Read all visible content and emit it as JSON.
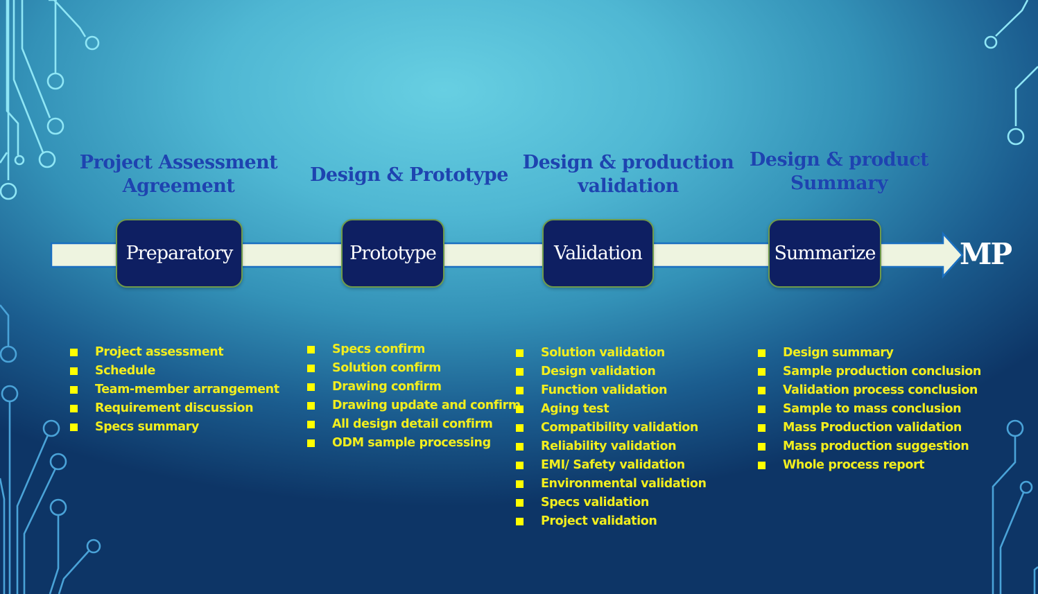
{
  "colors": {
    "title_text": "#1d44b0",
    "stage_box_fill": "#0e1f62",
    "stage_box_border": "#6f9a4a",
    "arrow_fill": "#eef4e0",
    "arrow_outline": "#1a6fc0",
    "task_text": "#f2ee1e",
    "bullet": "#ffff00",
    "circuit_line_light": "#8fe6f5",
    "circuit_line_dark": "#4aa3d8"
  },
  "phases": [
    {
      "title_line1": "Project Assessment",
      "title_line2": "Agreement",
      "stage": "Preparatory",
      "tasks": [
        "Project assessment",
        "Schedule",
        "Team-member arrangement",
        "Requirement discussion",
        "Specs summary"
      ]
    },
    {
      "title_line1": "Design & Prototype",
      "title_line2": "",
      "stage": "Prototype",
      "tasks": [
        "Specs confirm",
        "Solution confirm",
        "Drawing confirm",
        "Drawing update and confirm",
        "All design detail confirm",
        "ODM sample processing"
      ]
    },
    {
      "title_line1": "Design & production",
      "title_line2": "validation",
      "stage": "Validation",
      "tasks": [
        "Solution validation",
        "Design validation",
        "Function validation",
        "Aging test",
        "Compatibility validation",
        "Reliability validation",
        "EMI/ Safety validation",
        "Environmental validation",
        "Specs validation",
        "Project validation"
      ]
    },
    {
      "title_line1": "Design & product",
      "title_line2": "Summary",
      "stage": "Summarize",
      "tasks": [
        "Design summary",
        "Sample production conclusion",
        "Validation process conclusion",
        "Sample to mass conclusion",
        "Mass Production validation",
        "Mass production suggestion",
        "Whole process report"
      ]
    }
  ],
  "endpoint": "MP",
  "bullet_icon": "square-bullet-icon",
  "decoration_icon": "circuit-trace-icon"
}
